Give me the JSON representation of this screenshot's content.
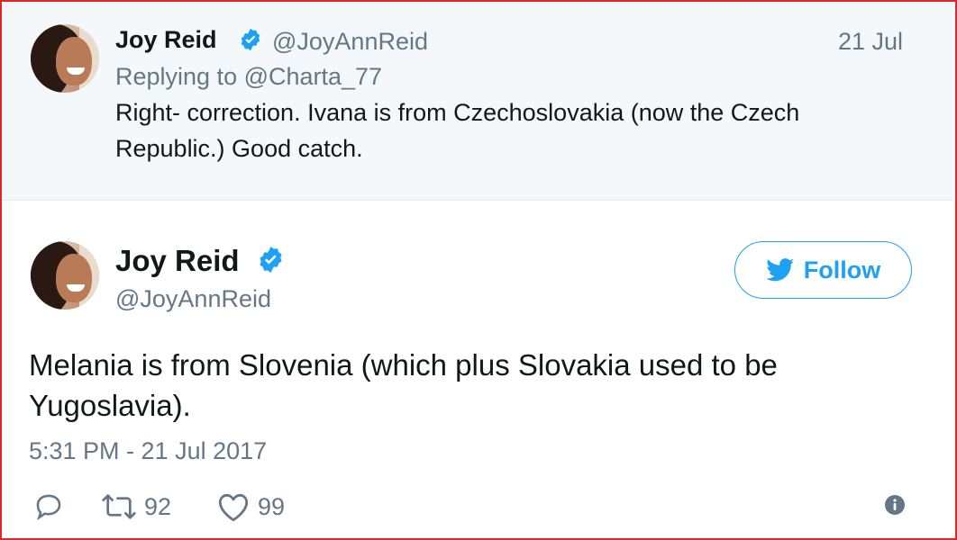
{
  "reply_tweet": {
    "display_name": "Joy Reid",
    "handle": "@JoyAnnReid",
    "date": "21 Jul",
    "replying_to": "Replying to @Charta_77",
    "text_line1": "Right- correction. Ivana is from Czechoslovakia (now the Czech",
    "text_line2": "Republic.) Good catch."
  },
  "main_tweet": {
    "display_name": "Joy Reid",
    "handle": "@JoyAnnReid",
    "follow_label": "Follow",
    "text_line1": "Melania is from Slovenia (which plus Slovakia used to be",
    "text_line2": "Yugoslavia).",
    "timestamp": "5:31 PM - 21 Jul 2017",
    "retweet_count": "92",
    "like_count": "99"
  },
  "colors": {
    "accent": "#1da1f2",
    "muted": "#657786",
    "reply_bg": "#f5f8fa",
    "border": "#e0262a"
  },
  "icons": [
    "verified-badge-icon",
    "twitter-bird-icon",
    "reply-icon",
    "retweet-icon",
    "like-icon",
    "info-icon"
  ]
}
